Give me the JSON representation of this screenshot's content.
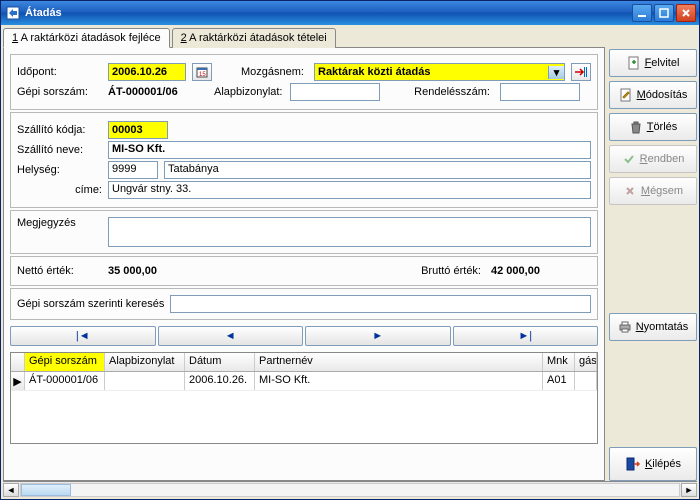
{
  "window": {
    "title": "Átadás"
  },
  "tabs": {
    "t1": "1 A raktárközi átadások fejléce",
    "t2": "2 A raktárközi átadások tételei"
  },
  "top": {
    "idopont_label": "Időpont:",
    "idopont_value": "2006.10.26",
    "mozgasnem_label": "Mozgásnem:",
    "mozgasnem_value": "Raktárak közti átadás",
    "gepi_label": "Gépi sorszám:",
    "gepi_value": "ÁT-000001/06",
    "alap_label": "Alapbizonylat:",
    "alap_value": "",
    "rend_label": "Rendelésszám:",
    "rend_value": ""
  },
  "szallito": {
    "kod_label": "Szállító kódja:",
    "kod_value": "00003",
    "nev_label": "Szállító neve:",
    "nev_value": "MI-SO Kft.",
    "helyseg_label": "Helység:",
    "helyseg_irsz": "9999",
    "helyseg_nev": "Tatabánya",
    "cim_label": "címe:",
    "cim_value": "Ungvár stny. 33."
  },
  "megj": {
    "label": "Megjegyzés"
  },
  "totals": {
    "netto_label": "Nettó érték:",
    "netto_value": "35 000,00",
    "brutto_label": "Bruttó érték:",
    "brutto_value": "42 000,00"
  },
  "search": {
    "label": "Gépi sorszám szerinti keresés"
  },
  "nav": {
    "first": "|◄",
    "prev": "◄",
    "next": "►",
    "last": "►|"
  },
  "grid": {
    "headers": {
      "c1": "Gépi sorszám",
      "c2": "Alapbizonylat",
      "c3": "Dátum",
      "c4": "Partnernév",
      "c5": "Mnk",
      "c6": "gás"
    },
    "rows": [
      {
        "c1": "ÁT-000001/06",
        "c2": "",
        "c3": "2006.10.26.",
        "c4": "MI-SO Kft.",
        "c5": "A01",
        "c6": ""
      }
    ]
  },
  "buttons": {
    "felvitel": "Felvitel",
    "modositas": "Módosítás",
    "torles": "Törlés",
    "rendben": "Rendben",
    "megsem": "Mégsem",
    "nyomtatas": "Nyomtatás",
    "kilepes": "Kilépés"
  }
}
